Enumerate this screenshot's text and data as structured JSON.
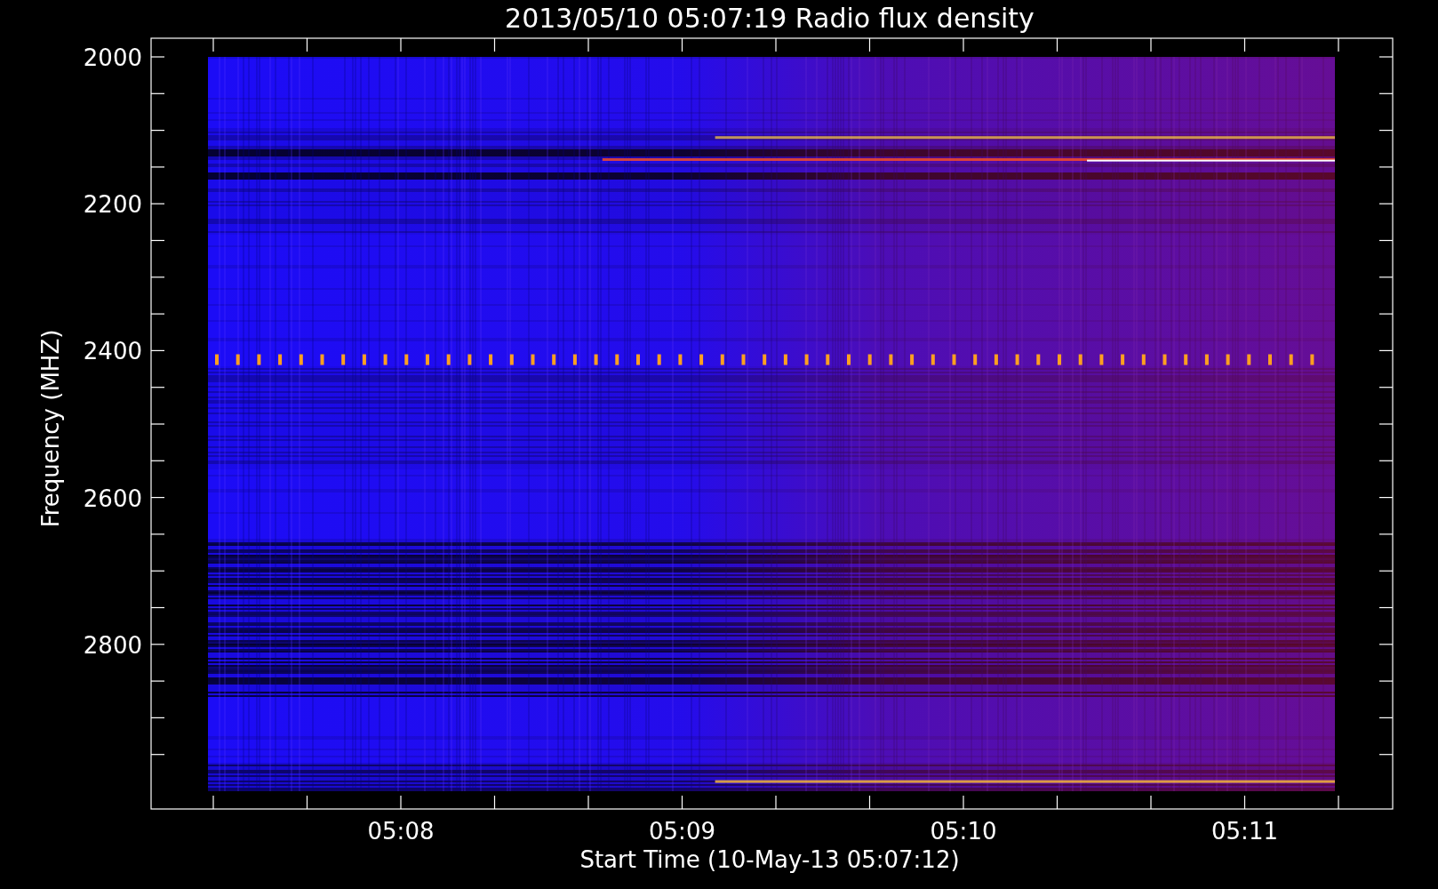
{
  "title": "2013/05/10 05:07:19 Radio flux density",
  "ylabel": "Frequency (MHZ)",
  "xlabel": "Start Time (10-May-13 05:07:12)",
  "yticks": [
    "2000",
    "2200",
    "2400",
    "2600",
    "2800"
  ],
  "xticks": [
    "05:08",
    "05:09",
    "05:10",
    "05:11"
  ]
}
